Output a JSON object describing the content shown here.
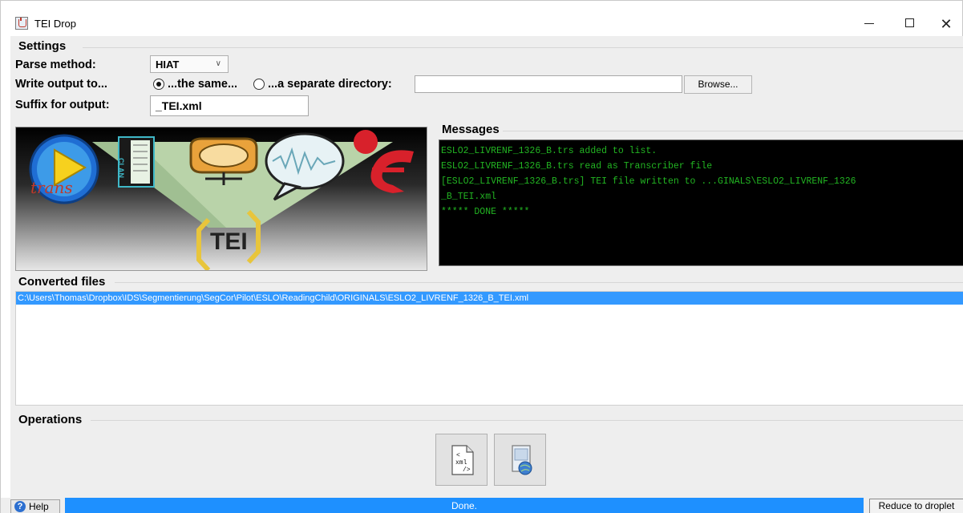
{
  "window": {
    "title": "TEI Drop",
    "minimize": "minimize",
    "maximize": "maximize",
    "close": "✕"
  },
  "settings": {
    "title": "Settings",
    "parse_method_label": "Parse method:",
    "parse_method_value": "HIAT",
    "write_output_label": "Write output to...",
    "radio_same_label": "...the same...",
    "radio_separate_label": "...a separate directory:",
    "radio_selected": "same",
    "directory_value": "",
    "browse_label": "Browse...",
    "suffix_label": "Suffix for output:",
    "suffix_value": "_TEI.xml"
  },
  "logo": {
    "text": "TEI",
    "clan_text": "CLAN",
    "trans_text": "trans",
    "icon_names": [
      "transcriber-icon",
      "clan-icon",
      "exmaralda-icon",
      "elan-icon",
      "chat-bubble-icon",
      "tei-icon"
    ],
    "accent_colors": {
      "gold": "#e8c53c",
      "red": "#d8212b",
      "blue": "#2a82d8",
      "green_bg": "#b9d3a9"
    }
  },
  "messages": {
    "title": "Messages",
    "lines": [
      "ESLO2_LIVRENF_1326_B.trs added to list.",
      "ESLO2_LIVRENF_1326_B.trs read as Transcriber file",
      "[ESLO2_LIVRENF_1326_B.trs] TEI file written to ...GINALS\\ESLO2_LIVRENF_1326",
      "_B_TEI.xml",
      "***** DONE *****"
    ],
    "text_color": "#22b422"
  },
  "converted": {
    "title": "Converted files",
    "files": [
      "C:\\Users\\Thomas\\Dropbox\\IDS\\Segmentierung\\SegCor\\Pilot\\ESLO\\ReadingChild\\ORIGINALS\\ESLO2_LIVRENF_1326_B_TEI.xml"
    ],
    "selected_color": "#3399ff"
  },
  "operations": {
    "title": "Operations",
    "buttons": [
      {
        "icon": "xml-file-icon",
        "text": "xml"
      },
      {
        "icon": "web-document-icon",
        "text": ""
      }
    ]
  },
  "status": {
    "help_label": "Help",
    "help_icon_glyph": "?",
    "progress_text": "Done.",
    "progress": 1.0,
    "reduce_label": "Reduce to droplet"
  }
}
